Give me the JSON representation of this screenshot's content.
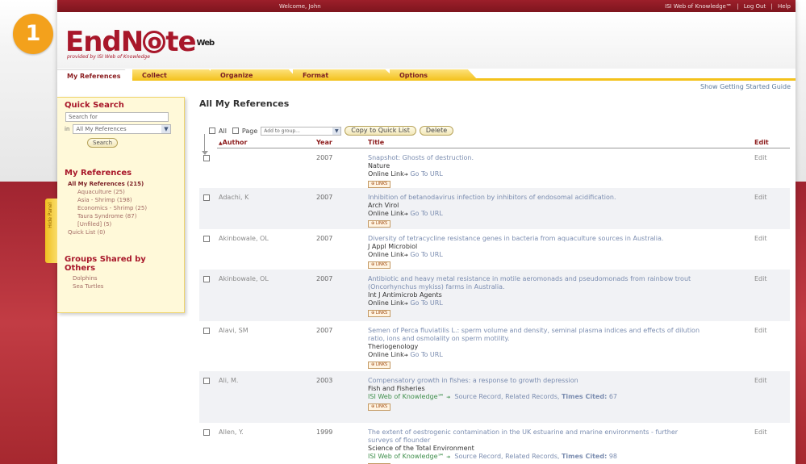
{
  "badge": "1",
  "topbar": {
    "welcome": "Welcome, John",
    "right_links": [
      "ISI Web of Knowledge℠",
      "|",
      "Log Out",
      "|",
      "Help"
    ]
  },
  "logo": {
    "text_before": "EndN",
    "text_o": "o",
    "text_after": "te",
    "sup": "Web",
    "reg": "®",
    "sub": "provided by ISI Web of Knowledge"
  },
  "tabs": [
    "My References",
    "Collect",
    "Organize",
    "Format",
    "Options"
  ],
  "guide_link": "Show Getting Started Guide",
  "hide_panel": "Hide Panel",
  "sidebar": {
    "quick_search_title": "Quick Search",
    "search_placeholder": "Search for",
    "in_label": "in",
    "scope_value": "All My References",
    "search_button": "Search",
    "my_refs_title": "My References",
    "all_refs": "All My References (215)",
    "groups": [
      "Aquaculture (25)",
      "Asia - Shrimp (198)",
      "Economics - Shrimp (25)",
      "Taura Syndrome (87)",
      "[Unfiled] (5)"
    ],
    "quick_list": "Quick List (0)",
    "shared_title_1": "Groups Shared by",
    "shared_title_2": "Others",
    "shared_groups": [
      "Dolphins",
      "Sea Turtles"
    ]
  },
  "main": {
    "title": "All My References",
    "toolbar": {
      "all_label": "All",
      "page_label": "Page",
      "group_placeholder": "Add to group...",
      "copy_button": "Copy to Quick List",
      "delete_button": "Delete"
    },
    "columns": {
      "author": "Author",
      "author_arrow": "▲",
      "year": "Year",
      "title": "Title",
      "edit": "Edit"
    },
    "links_label": "⊕ LINKS",
    "rows": [
      {
        "author": "",
        "year": "2007",
        "title_lines": [
          "Snapshot: Ghosts of destruction."
        ],
        "journal": "Nature",
        "online_label": "Online Link",
        "online_arrow": "➔",
        "online_url": "Go To URL",
        "wok": null,
        "edit": "Edit"
      },
      {
        "author": "Adachi, K",
        "year": "2007",
        "title_lines": [
          "Inhibition of betanodavirus infection by inhibitors of endosomal acidification."
        ],
        "journal": "Arch Virol",
        "online_label": "Online Link",
        "online_arrow": "➔",
        "online_url": "Go To URL",
        "wok": null,
        "edit": "Edit"
      },
      {
        "author": "Akinbowale, OL",
        "year": "2007",
        "title_lines": [
          "Diversity of tetracycline resistance genes in bacteria from aquaculture sources in Australia."
        ],
        "journal": "J Appl Microbiol",
        "online_label": "Online Link",
        "online_arrow": "➔",
        "online_url": "Go To URL",
        "wok": null,
        "edit": "Edit"
      },
      {
        "author": "Akinbowale, OL",
        "year": "2007",
        "title_lines": [
          "Antibiotic and heavy metal resistance in motile aeromonads and pseudomonads from rainbow trout",
          "(Oncorhynchus mykiss) farms in Australia."
        ],
        "journal": "Int J Antimicrob Agents",
        "online_label": "Online Link",
        "online_arrow": "➔",
        "online_url": "Go To URL",
        "wok": null,
        "edit": "Edit"
      },
      {
        "author": "Alavi, SM",
        "year": "2007",
        "title_lines": [
          "Semen of Perca fluviatilis L.: sperm volume and density, seminal plasma indices and effects of dilution",
          "ratio, ions and osmolality on sperm motility."
        ],
        "journal": "Theriogenology",
        "online_label": "Online Link",
        "online_arrow": "➔",
        "online_url": "Go To URL",
        "wok": null,
        "edit": "Edit"
      },
      {
        "author": "Ali, M.",
        "year": "2003",
        "title_lines": [
          "Compensatory growth in fishes: a response to growth depression"
        ],
        "journal": "Fish and Fisheries",
        "online_label": null,
        "online_arrow": null,
        "online_url": null,
        "wok": {
          "label": "ISI Web of Knowledge℠",
          "arrow": "➔",
          "links": "Source Record, Related Records,",
          "cited_label": "Times Cited:",
          "cited": "67"
        },
        "edit": "Edit"
      },
      {
        "author": "Allen, Y.",
        "year": "1999",
        "title_lines": [
          "The extent of oestrogenic contamination in the UK estuarine and marine environments - further",
          "surveys of flounder"
        ],
        "journal": "Science of the Total Environment",
        "online_label": null,
        "online_arrow": null,
        "online_url": null,
        "wok": {
          "label": "ISI Web of Knowledge℠",
          "arrow": "➔",
          "links": "Source Record, Related Records,",
          "cited_label": "Times Cited:",
          "cited": "98"
        },
        "edit": "Edit"
      }
    ]
  },
  "colors": {
    "brand_red": "#a8172a",
    "tab_yellow": "#f3c11a",
    "link_blue": "#7b8db0",
    "wok_green": "#3f8f4c",
    "badge_orange": "#f3a11c"
  }
}
